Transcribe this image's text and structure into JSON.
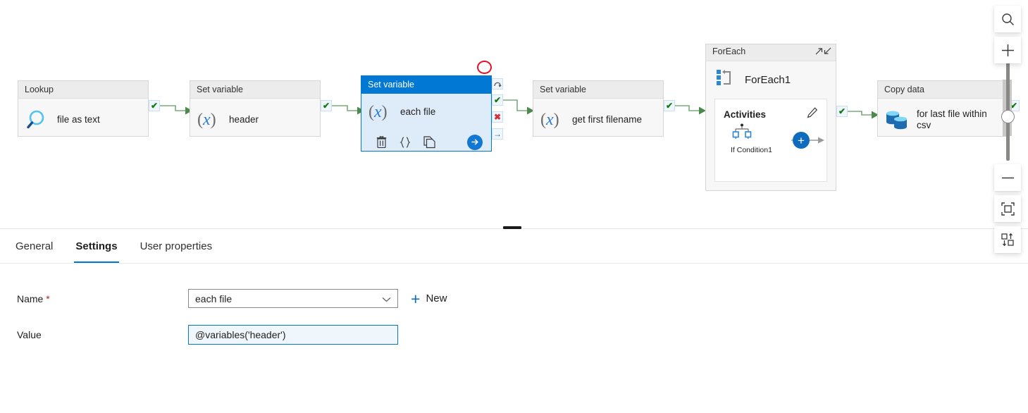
{
  "canvas": {
    "nodes": [
      {
        "type_label": "Lookup",
        "name": "file as text",
        "icon": "lookup-magnifier-icon"
      },
      {
        "type_label": "Set variable",
        "name": "header",
        "icon": "set-variable-icon"
      },
      {
        "type_label": "Set variable",
        "name": "each file",
        "icon": "set-variable-icon",
        "selected": true
      },
      {
        "type_label": "Set variable",
        "name": "get first filename",
        "icon": "set-variable-icon"
      },
      {
        "type_label": "Copy data",
        "name": "for last file within csv",
        "icon": "copy-data-database-icon"
      }
    ],
    "selected_node_toolbar": {
      "delete_label": "🗑",
      "code_label": "{ }",
      "clone_label": "❐",
      "open_label": "→"
    },
    "connector_handles": {
      "skipped": "↷",
      "success": "✔",
      "failure": "✖",
      "completion": "→"
    },
    "container": {
      "type_label": "ForEach",
      "name": "ForEach1",
      "activities_label": "Activities",
      "edit_icon": "pencil-icon",
      "expand_icon": "expand-arrow-icon",
      "collapse_icon": "collapse-arrow-icon",
      "inner_activity": "If Condition1",
      "add_label": "+"
    }
  },
  "rail": {
    "search_label": "⌕",
    "zoom_in_label": "+",
    "zoom_out_label": "−",
    "fit_label": "fit-to-screen",
    "align_label": "auto-align"
  },
  "panel": {
    "tabs": [
      {
        "label": "General",
        "active": false
      },
      {
        "label": "Settings",
        "active": true
      },
      {
        "label": "User properties",
        "active": false
      }
    ],
    "collapse_icon": "chevron-up-icon",
    "form": {
      "name_label": "Name",
      "name_required": "*",
      "name_value": "each file",
      "new_label": "New",
      "value_label": "Value",
      "value_value": "@variables('header')"
    }
  },
  "colors": {
    "accent": "#0078d4",
    "success": "#107c10",
    "failure": "#d13438",
    "annotation": "#e81123",
    "node_header": "#ececec"
  }
}
